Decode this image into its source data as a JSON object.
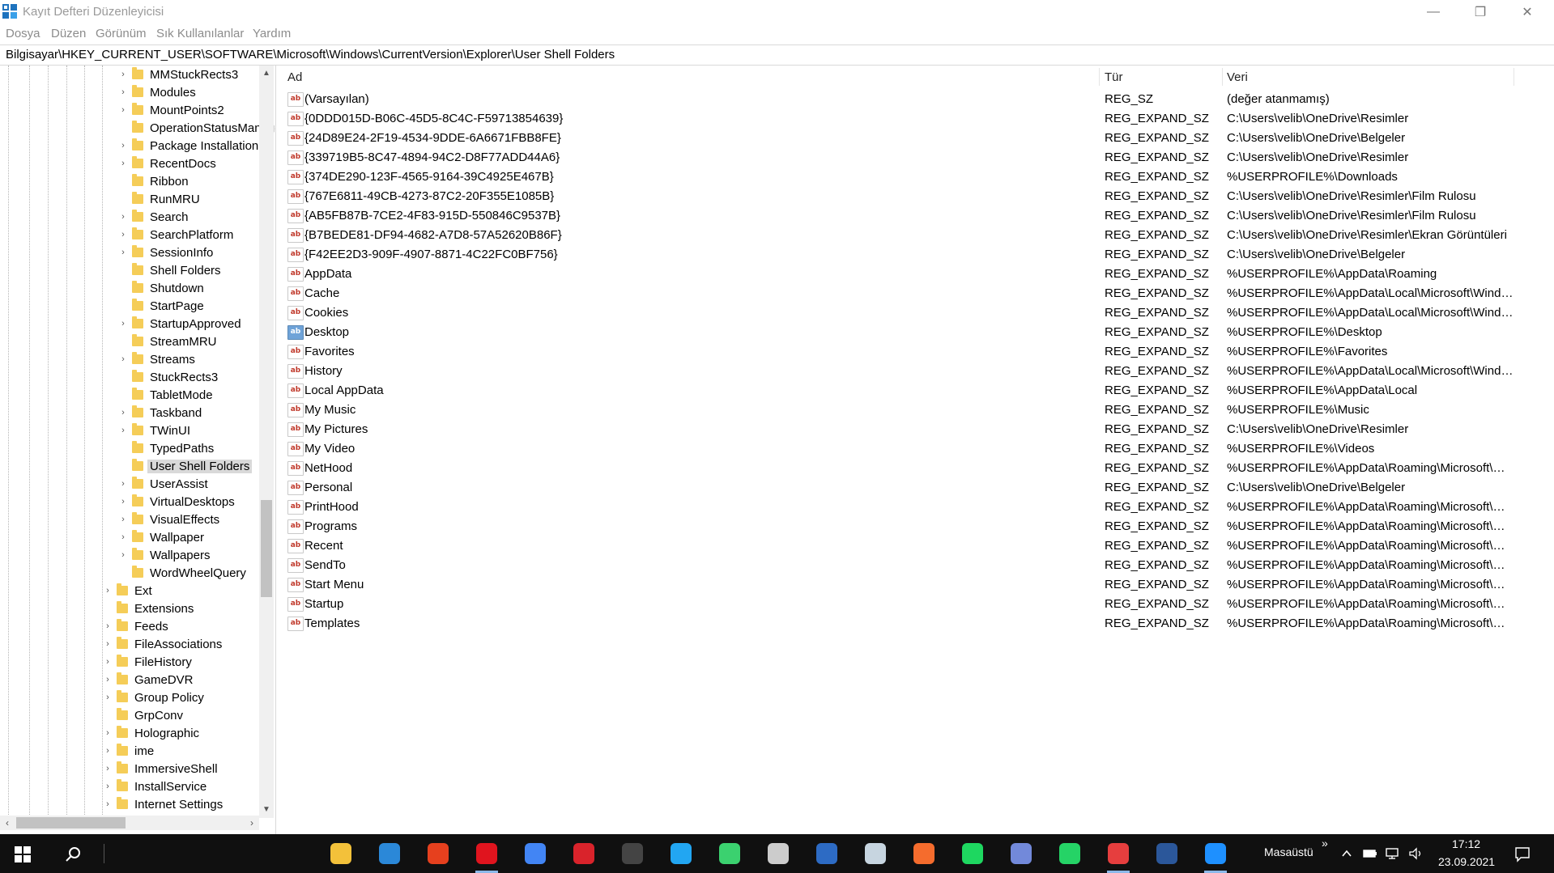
{
  "window": {
    "title": "Kayıt Defteri Düzenleyicisi",
    "controls": {
      "minimize": "—",
      "maximize": "❐",
      "close": "✕"
    }
  },
  "menu": [
    "Dosya",
    "Düzen",
    "Görünüm",
    "Sık Kullanılanlar",
    "Yardım"
  ],
  "address": "Bilgisayar\\HKEY_CURRENT_USER\\SOFTWARE\\Microsoft\\Windows\\CurrentVersion\\Explorer\\User Shell Folders",
  "tree": {
    "items": [
      {
        "label": "MMStuckRects3",
        "expandable": true
      },
      {
        "label": "Modules",
        "expandable": true
      },
      {
        "label": "MountPoints2",
        "expandable": true
      },
      {
        "label": "OperationStatusManager",
        "expandable": false
      },
      {
        "label": "Package Installation",
        "expandable": true
      },
      {
        "label": "RecentDocs",
        "expandable": true
      },
      {
        "label": "Ribbon",
        "expandable": false
      },
      {
        "label": "RunMRU",
        "expandable": false
      },
      {
        "label": "Search",
        "expandable": true
      },
      {
        "label": "SearchPlatform",
        "expandable": true
      },
      {
        "label": "SessionInfo",
        "expandable": true
      },
      {
        "label": "Shell Folders",
        "expandable": false
      },
      {
        "label": "Shutdown",
        "expandable": false
      },
      {
        "label": "StartPage",
        "expandable": false
      },
      {
        "label": "StartupApproved",
        "expandable": true
      },
      {
        "label": "StreamMRU",
        "expandable": false
      },
      {
        "label": "Streams",
        "expandable": true
      },
      {
        "label": "StuckRects3",
        "expandable": false
      },
      {
        "label": "TabletMode",
        "expandable": false
      },
      {
        "label": "Taskband",
        "expandable": true
      },
      {
        "label": "TWinUI",
        "expandable": true
      },
      {
        "label": "TypedPaths",
        "expandable": false
      },
      {
        "label": "User Shell Folders",
        "expandable": false,
        "selected": true
      },
      {
        "label": "UserAssist",
        "expandable": true
      },
      {
        "label": "VirtualDesktops",
        "expandable": true
      },
      {
        "label": "VisualEffects",
        "expandable": true
      },
      {
        "label": "Wallpaper",
        "expandable": true
      },
      {
        "label": "Wallpapers",
        "expandable": true
      },
      {
        "label": "WordWheelQuery",
        "expandable": false
      },
      {
        "label": "Ext",
        "expandable": true,
        "level": 1
      },
      {
        "label": "Extensions",
        "expandable": false,
        "level": 1
      },
      {
        "label": "Feeds",
        "expandable": true,
        "level": 1
      },
      {
        "label": "FileAssociations",
        "expandable": true,
        "level": 1
      },
      {
        "label": "FileHistory",
        "expandable": true,
        "level": 1
      },
      {
        "label": "GameDVR",
        "expandable": true,
        "level": 1
      },
      {
        "label": "Group Policy",
        "expandable": true,
        "level": 1
      },
      {
        "label": "GrpConv",
        "expandable": false,
        "level": 1
      },
      {
        "label": "Holographic",
        "expandable": true,
        "level": 1
      },
      {
        "label": "ime",
        "expandable": true,
        "level": 1
      },
      {
        "label": "ImmersiveShell",
        "expandable": true,
        "level": 1
      },
      {
        "label": "InstallService",
        "expandable": true,
        "level": 1
      },
      {
        "label": "Internet Settings",
        "expandable": true,
        "level": 1
      }
    ]
  },
  "values_table": {
    "headers": {
      "name": "Ad",
      "type": "Tür",
      "data": "Veri"
    },
    "rows": [
      {
        "name": "(Varsayılan)",
        "type": "REG_SZ",
        "data": "(değer atanmamış)"
      },
      {
        "name": "{0DDD015D-B06C-45D5-8C4C-F59713854639}",
        "type": "REG_EXPAND_SZ",
        "data": "C:\\Users\\velib\\OneDrive\\Resimler"
      },
      {
        "name": "{24D89E24-2F19-4534-9DDE-6A6671FBB8FE}",
        "type": "REG_EXPAND_SZ",
        "data": "C:\\Users\\velib\\OneDrive\\Belgeler"
      },
      {
        "name": "{339719B5-8C47-4894-94C2-D8F77ADD44A6}",
        "type": "REG_EXPAND_SZ",
        "data": "C:\\Users\\velib\\OneDrive\\Resimler"
      },
      {
        "name": "{374DE290-123F-4565-9164-39C4925E467B}",
        "type": "REG_EXPAND_SZ",
        "data": "%USERPROFILE%\\Downloads"
      },
      {
        "name": "{767E6811-49CB-4273-87C2-20F355E1085B}",
        "type": "REG_EXPAND_SZ",
        "data": "C:\\Users\\velib\\OneDrive\\Resimler\\Film Rulosu"
      },
      {
        "name": "{AB5FB87B-7CE2-4F83-915D-550846C9537B}",
        "type": "REG_EXPAND_SZ",
        "data": "C:\\Users\\velib\\OneDrive\\Resimler\\Film Rulosu"
      },
      {
        "name": "{B7BEDE81-DF94-4682-A7D8-57A52620B86F}",
        "type": "REG_EXPAND_SZ",
        "data": "C:\\Users\\velib\\OneDrive\\Resimler\\Ekran Görüntüleri"
      },
      {
        "name": "{F42EE2D3-909F-4907-8871-4C22FC0BF756}",
        "type": "REG_EXPAND_SZ",
        "data": "C:\\Users\\velib\\OneDrive\\Belgeler"
      },
      {
        "name": "AppData",
        "type": "REG_EXPAND_SZ",
        "data": "%USERPROFILE%\\AppData\\Roaming"
      },
      {
        "name": "Cache",
        "type": "REG_EXPAND_SZ",
        "data": "%USERPROFILE%\\AppData\\Local\\Microsoft\\Windo..."
      },
      {
        "name": "Cookies",
        "type": "REG_EXPAND_SZ",
        "data": "%USERPROFILE%\\AppData\\Local\\Microsoft\\Windo..."
      },
      {
        "name": "Desktop",
        "type": "REG_EXPAND_SZ",
        "data": "%USERPROFILE%\\Desktop",
        "icon": "desktop-value-icon"
      },
      {
        "name": "Favorites",
        "type": "REG_EXPAND_SZ",
        "data": "%USERPROFILE%\\Favorites"
      },
      {
        "name": "History",
        "type": "REG_EXPAND_SZ",
        "data": "%USERPROFILE%\\AppData\\Local\\Microsoft\\Windo..."
      },
      {
        "name": "Local AppData",
        "type": "REG_EXPAND_SZ",
        "data": "%USERPROFILE%\\AppData\\Local"
      },
      {
        "name": "My Music",
        "type": "REG_EXPAND_SZ",
        "data": "%USERPROFILE%\\Music"
      },
      {
        "name": "My Pictures",
        "type": "REG_EXPAND_SZ",
        "data": "C:\\Users\\velib\\OneDrive\\Resimler"
      },
      {
        "name": "My Video",
        "type": "REG_EXPAND_SZ",
        "data": "%USERPROFILE%\\Videos"
      },
      {
        "name": "NetHood",
        "type": "REG_EXPAND_SZ",
        "data": "%USERPROFILE%\\AppData\\Roaming\\Microsoft\\Wi..."
      },
      {
        "name": "Personal",
        "type": "REG_EXPAND_SZ",
        "data": "C:\\Users\\velib\\OneDrive\\Belgeler"
      },
      {
        "name": "PrintHood",
        "type": "REG_EXPAND_SZ",
        "data": "%USERPROFILE%\\AppData\\Roaming\\Microsoft\\Wi..."
      },
      {
        "name": "Programs",
        "type": "REG_EXPAND_SZ",
        "data": "%USERPROFILE%\\AppData\\Roaming\\Microsoft\\Wi..."
      },
      {
        "name": "Recent",
        "type": "REG_EXPAND_SZ",
        "data": "%USERPROFILE%\\AppData\\Roaming\\Microsoft\\Wi..."
      },
      {
        "name": "SendTo",
        "type": "REG_EXPAND_SZ",
        "data": "%USERPROFILE%\\AppData\\Roaming\\Microsoft\\Wi..."
      },
      {
        "name": "Start Menu",
        "type": "REG_EXPAND_SZ",
        "data": "%USERPROFILE%\\AppData\\Roaming\\Microsoft\\Wi..."
      },
      {
        "name": "Startup",
        "type": "REG_EXPAND_SZ",
        "data": "%USERPROFILE%\\AppData\\Roaming\\Microsoft\\Wi..."
      },
      {
        "name": "Templates",
        "type": "REG_EXPAND_SZ",
        "data": "%USERPROFILE%\\AppData\\Roaming\\Microsoft\\Wi..."
      }
    ]
  },
  "taskbar": {
    "apps": [
      {
        "name": "file-explorer-icon",
        "color": "#f3c13a"
      },
      {
        "name": "mail-icon",
        "color": "#2b88d8"
      },
      {
        "name": "office-icon",
        "color": "#e6401e"
      },
      {
        "name": "opera-icon",
        "color": "#e0141e",
        "active": true
      },
      {
        "name": "chrome-icon",
        "color": "#4285f4"
      },
      {
        "name": "app-red-icon",
        "color": "#d9232b"
      },
      {
        "name": "obs-icon",
        "color": "#444444"
      },
      {
        "name": "vscode-icon",
        "color": "#22a6f2"
      },
      {
        "name": "cleaner-icon",
        "color": "#3bd16f"
      },
      {
        "name": "terminal-icon",
        "color": "#cccccc"
      },
      {
        "name": "powershell-icon",
        "color": "#2d6bc4"
      },
      {
        "name": "steam-icon",
        "color": "#c7d5e0"
      },
      {
        "name": "origin-icon",
        "color": "#f56c2d"
      },
      {
        "name": "spotify-icon",
        "color": "#1ed760"
      },
      {
        "name": "discord-icon",
        "color": "#7289da"
      },
      {
        "name": "whatsapp-icon",
        "color": "#25d366"
      },
      {
        "name": "app-active-icon",
        "color": "#e63e3e",
        "active": true
      },
      {
        "name": "word-icon",
        "color": "#2b579a"
      },
      {
        "name": "regedit-icon",
        "color": "#1e90ff",
        "active": true
      }
    ],
    "desktop_label": "Masaüstü",
    "more_chevron": "»",
    "time": "17:12",
    "date": "23.09.2021"
  }
}
